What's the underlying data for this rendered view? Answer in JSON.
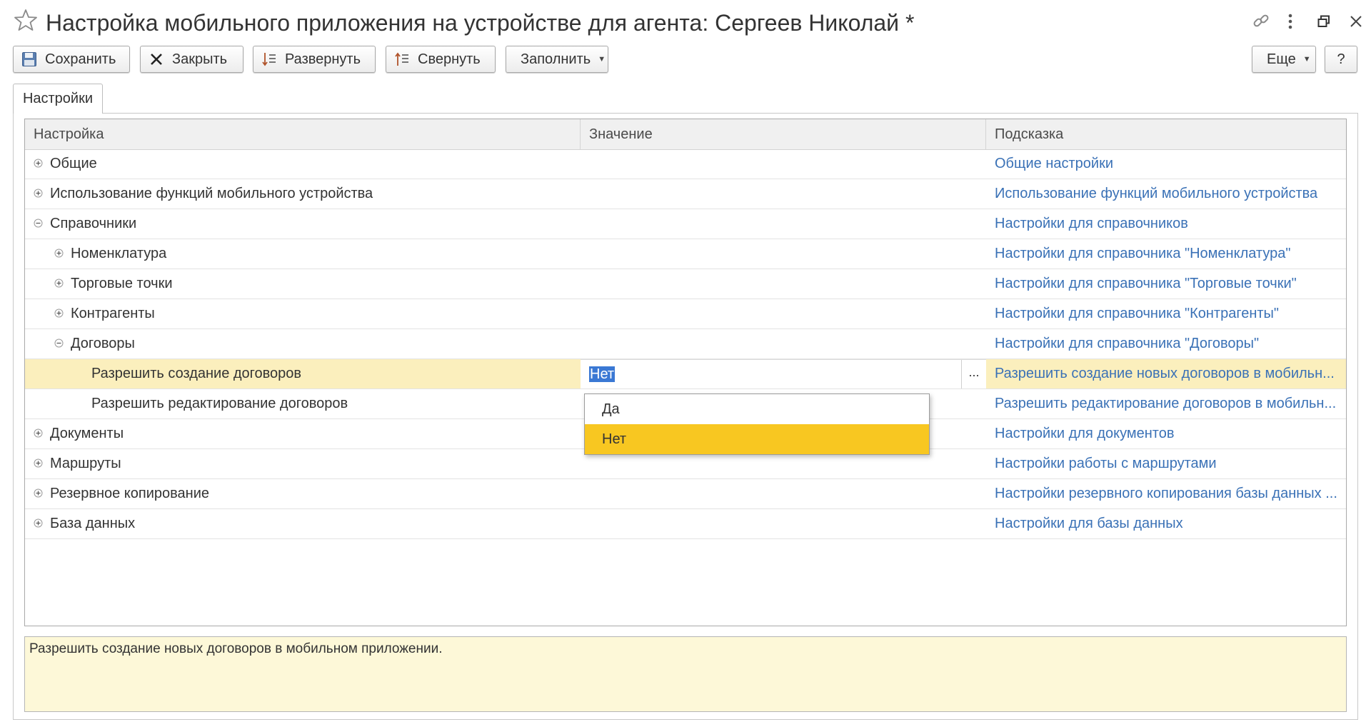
{
  "window": {
    "title": "Настройка мобильного приложения на устройстве для агента: Сергеев Николай *",
    "icons": [
      "star-icon",
      "link-icon",
      "more-vertical-icon",
      "restore-window-icon",
      "close-icon"
    ]
  },
  "toolbar": {
    "save_label": "Сохранить",
    "close_label": "Закрыть",
    "expand_label": "Развернуть",
    "collapse_label": "Свернуть",
    "fill_label": "Заполнить",
    "more_label": "Еще",
    "help_label": "?"
  },
  "tabs": [
    {
      "label": "Настройки",
      "active": true
    }
  ],
  "table": {
    "columns": [
      "Настройка",
      "Значение",
      "Подсказка"
    ],
    "rows": [
      {
        "name": "Общие",
        "level": 0,
        "node": "expand",
        "value": "",
        "hint": "Общие настройки"
      },
      {
        "name": "Использование функций мобильного устройства",
        "level": 0,
        "node": "expand",
        "value": "",
        "hint": "Использование функций мобильного устройства"
      },
      {
        "name": "Справочники",
        "level": 0,
        "node": "collapse",
        "value": "",
        "hint": "Настройки для справочников"
      },
      {
        "name": "Номенклатура",
        "level": 1,
        "node": "expand",
        "value": "",
        "hint": "Настройки для справочника \"Номенклатура\""
      },
      {
        "name": "Торговые точки",
        "level": 1,
        "node": "expand",
        "value": "",
        "hint": "Настройки для справочника \"Торговые точки\""
      },
      {
        "name": "Контрагенты",
        "level": 1,
        "node": "expand",
        "value": "",
        "hint": "Настройки для справочника \"Контрагенты\""
      },
      {
        "name": "Договоры",
        "level": 1,
        "node": "collapse",
        "value": "",
        "hint": "Настройки для справочника \"Договоры\""
      },
      {
        "name": "Разрешить создание договоров",
        "level": 2,
        "node": "none",
        "value": "Нет",
        "hint": "Разрешить создание новых договоров в мобильн...",
        "selected": true
      },
      {
        "name": "Разрешить редактирование договоров",
        "level": 2,
        "node": "none",
        "value": "",
        "hint": "Разрешить редактирование договоров в мобильн..."
      },
      {
        "name": "Документы",
        "level": 0,
        "node": "expand",
        "value": "",
        "hint": "Настройки для документов"
      },
      {
        "name": "Маршруты",
        "level": 0,
        "node": "expand",
        "value": "",
        "hint": "Настройки работы с маршрутами"
      },
      {
        "name": "Резервное копирование",
        "level": 0,
        "node": "expand",
        "value": "",
        "hint": "Настройки резервного копирования базы данных ..."
      },
      {
        "name": "База данных",
        "level": 0,
        "node": "expand",
        "value": "",
        "hint": "Настройки для базы данных"
      }
    ]
  },
  "dropdown": {
    "options": [
      "Да",
      "Нет"
    ],
    "selected": "Нет"
  },
  "description": "Разрешить создание новых договоров в мобильном приложении.",
  "colors": {
    "hint_link": "#3a71b6",
    "selected_row": "#fbefbd",
    "dropdown_active": "#f8c721",
    "text_selection": "#3a78d4",
    "description_bg": "#fdf8d8"
  }
}
